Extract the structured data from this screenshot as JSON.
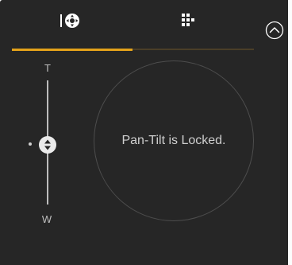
{
  "tabs": [
    {
      "icon": "pan-tilt-icon",
      "active": true
    },
    {
      "icon": "preset-grid-icon",
      "active": false
    }
  ],
  "accent_color": "#e3a21a",
  "collapse_icon": "chevron-up-circle-icon",
  "zoom": {
    "tele_label": "T",
    "wide_label": "W",
    "position": 0.5
  },
  "pantilt": {
    "status": "Pan-Tilt is Locked."
  }
}
